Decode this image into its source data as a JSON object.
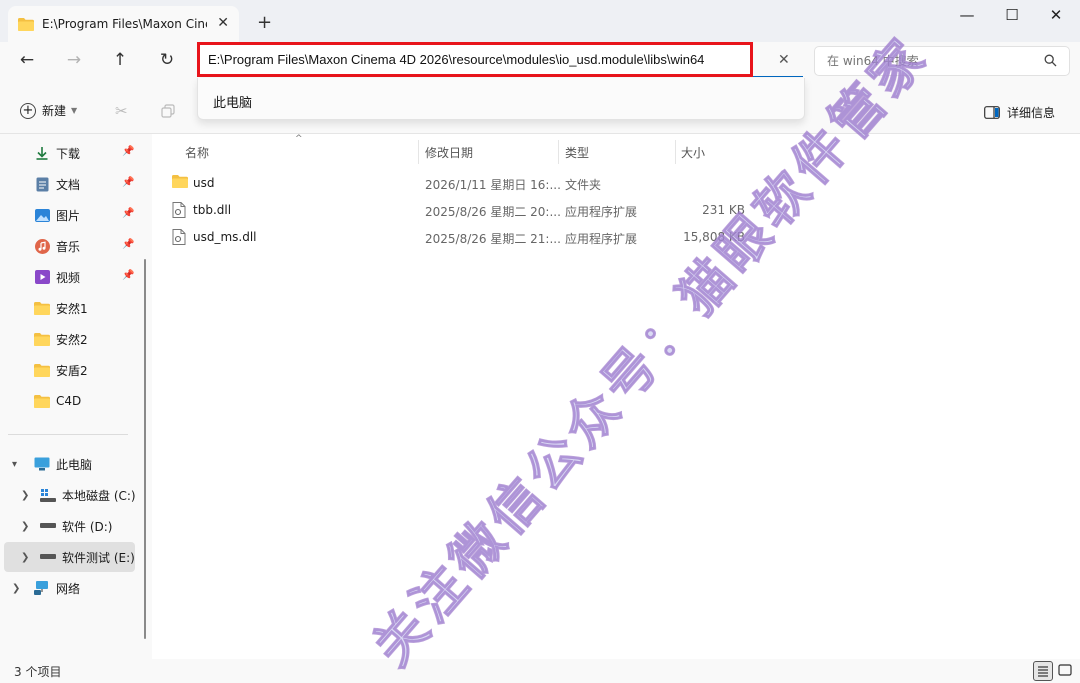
{
  "window": {
    "tab_title": "E:\\Program Files\\Maxon Cinen",
    "tab_close": "✕",
    "new_tab": "+",
    "minimize": "—",
    "maximize": "☐",
    "close": "✕"
  },
  "nav": {
    "back": "←",
    "forward": "→",
    "up": "↑",
    "refresh": "↻"
  },
  "address": {
    "value": "E:\\Program Files\\Maxon Cinema 4D 2026\\resource\\modules\\io_usd.module\\libs\\win64",
    "clear": "✕",
    "suggestion": "此电脑",
    "highlight_color": "#e8141b"
  },
  "search": {
    "placeholder": "在 win64 中搜索"
  },
  "toolbar": {
    "new_label": "新建",
    "details_label": "详细信息"
  },
  "sidebar": {
    "quick_access": [
      {
        "label": "下载",
        "icon": "download-icon",
        "pinned": true
      },
      {
        "label": "文档",
        "icon": "document-icon",
        "pinned": true
      },
      {
        "label": "图片",
        "icon": "picture-icon",
        "pinned": true
      },
      {
        "label": "音乐",
        "icon": "music-icon",
        "pinned": true
      },
      {
        "label": "视频",
        "icon": "video-icon",
        "pinned": true
      },
      {
        "label": "安然1",
        "icon": "folder-icon",
        "pinned": false
      },
      {
        "label": "安然2",
        "icon": "folder-icon",
        "pinned": false
      },
      {
        "label": "安盾2",
        "icon": "folder-icon",
        "pinned": false
      },
      {
        "label": "C4D",
        "icon": "folder-icon",
        "pinned": false
      }
    ],
    "this_pc": "此电脑",
    "drives": [
      {
        "label": "本地磁盘 (C:)",
        "icon": "system-drive-icon"
      },
      {
        "label": "软件 (D:)",
        "icon": "drive-icon"
      },
      {
        "label": "软件测试 (E:)",
        "icon": "drive-icon",
        "selected": true
      }
    ],
    "network": "网络"
  },
  "file_list": {
    "columns": [
      "名称",
      "修改日期",
      "类型",
      "大小"
    ],
    "rows": [
      {
        "name": "usd",
        "date": "2026/1/11 星期日 16:...",
        "type": "文件夹",
        "size": "",
        "icon": "folder-icon"
      },
      {
        "name": "tbb.dll",
        "date": "2025/8/26 星期二 20:...",
        "type": "应用程序扩展",
        "size": "231 KB",
        "icon": "dll-file-icon"
      },
      {
        "name": "usd_ms.dll",
        "date": "2025/8/26 星期二 21:...",
        "type": "应用程序扩展",
        "size": "15,808 KB",
        "icon": "dll-file-icon"
      }
    ]
  },
  "status": {
    "item_count": "3 个项目"
  },
  "watermark": {
    "text": "关注微信公众号：猫眼软件管家"
  }
}
